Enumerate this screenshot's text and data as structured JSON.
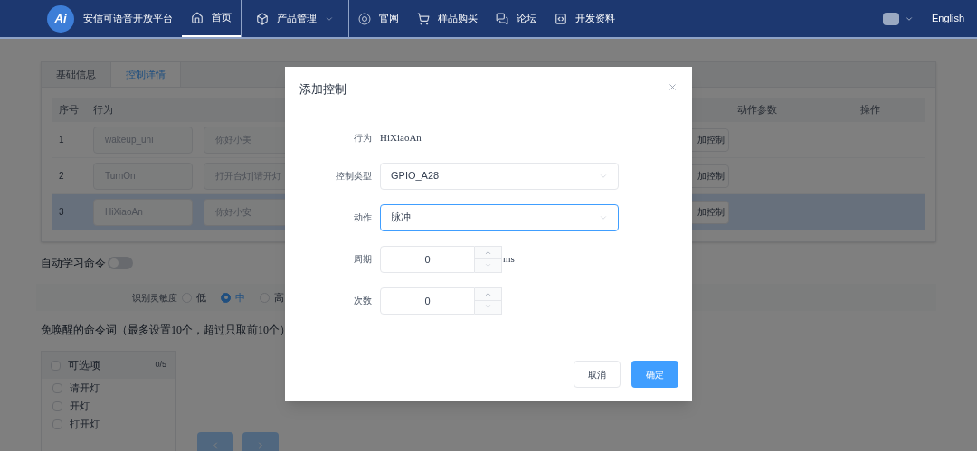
{
  "header": {
    "logo_text": "Ai",
    "title": "安信可语音开放平台",
    "nav": [
      {
        "label": "首页",
        "kind": "home",
        "dropdown": false,
        "selected": true
      },
      {
        "label": "产品管理",
        "kind": "box",
        "dropdown": true,
        "selected": false
      },
      {
        "label": "官网",
        "kind": "ai",
        "dropdown": false,
        "selected": false
      },
      {
        "label": "样品购买",
        "kind": "cart",
        "dropdown": false,
        "selected": false
      },
      {
        "label": "论坛",
        "kind": "chat",
        "dropdown": false,
        "selected": false
      },
      {
        "label": "开发资料",
        "kind": "doc",
        "dropdown": false,
        "selected": false
      }
    ],
    "language": "English"
  },
  "tabs": [
    {
      "label": "基础信息",
      "selected": false
    },
    {
      "label": "控制详情",
      "selected": true
    }
  ],
  "table": {
    "columns": [
      "序号",
      "行为",
      "动作参数",
      "操作"
    ],
    "rows": [
      {
        "index": "1",
        "behavior": "wakeup_uni",
        "phrases": "你好小美",
        "action": "加控制",
        "selected": false
      },
      {
        "index": "2",
        "behavior": "TurnOn",
        "phrases": "打开台灯|请开灯",
        "action": "加控制",
        "selected": false
      },
      {
        "index": "3",
        "behavior": "HiXiaoAn",
        "phrases": "你好小安",
        "action": "加控制",
        "selected": true
      }
    ]
  },
  "auto_learn": {
    "label": "自动学习命令",
    "on": false
  },
  "sensitivity": {
    "label": "识别灵敏度",
    "options": [
      {
        "label": "低",
        "selected": false
      },
      {
        "label": "中",
        "selected": true
      },
      {
        "label": "高",
        "selected": false
      }
    ]
  },
  "wakefree": {
    "title": "免唤醒的命令词（最多设置10个，超过只取前10个）",
    "transfer": {
      "title": "可选项",
      "count": "0/5",
      "checked": false,
      "items": [
        {
          "label": "请开灯",
          "checked": false
        },
        {
          "label": "开灯",
          "checked": false
        },
        {
          "label": "打开灯",
          "checked": false
        }
      ]
    }
  },
  "dialog": {
    "title": "添加控制",
    "fields": [
      {
        "kind": "text",
        "label": "行为",
        "value": "HiXiaoAn"
      },
      {
        "kind": "select",
        "label": "控制类型",
        "value": "GPIO_A28",
        "focused": false
      },
      {
        "kind": "select",
        "label": "动作",
        "value": "脉冲",
        "focused": true
      },
      {
        "kind": "number",
        "label": "周期",
        "value": "0",
        "unit": "ms"
      },
      {
        "kind": "number",
        "label": "次数",
        "value": "0"
      }
    ],
    "buttons": [
      {
        "label": "取消",
        "primary": false
      },
      {
        "label": "确定",
        "primary": true
      }
    ]
  }
}
